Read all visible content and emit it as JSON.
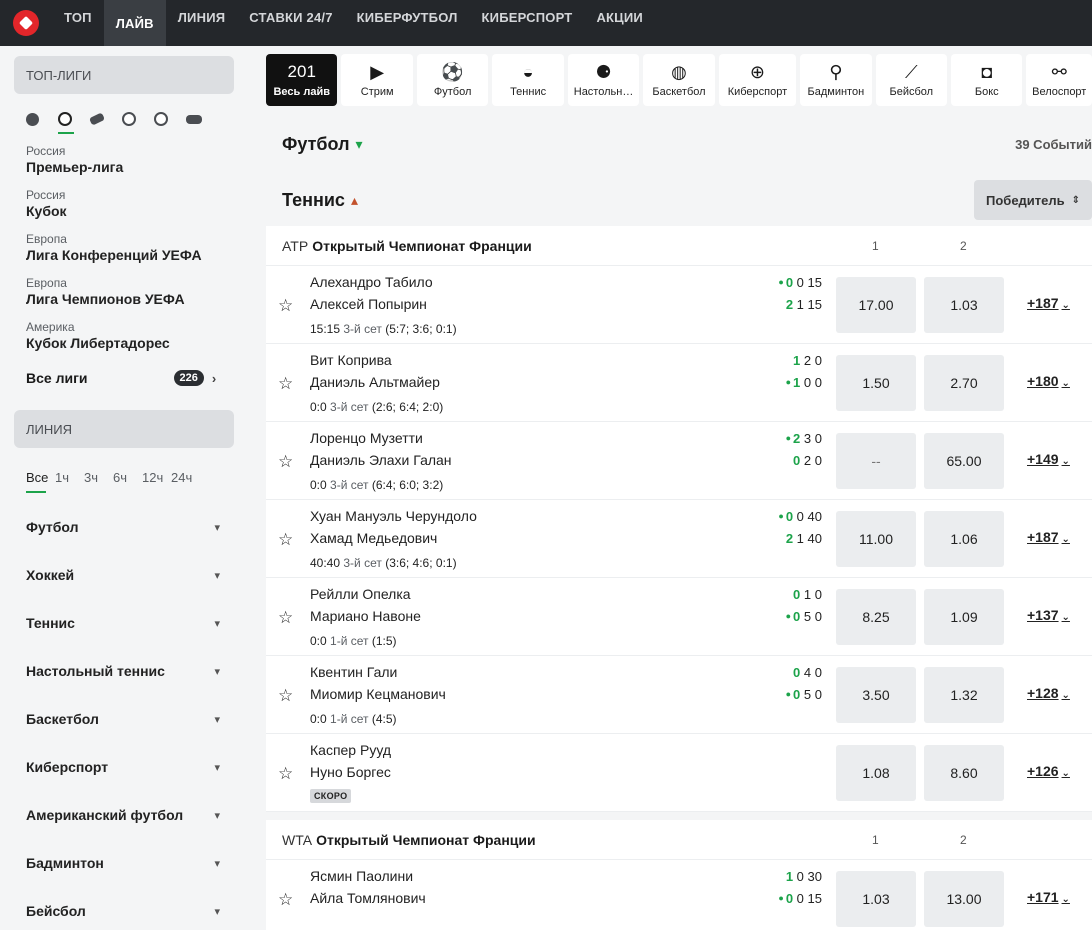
{
  "topnav": {
    "items": [
      {
        "label": "ТОП"
      },
      {
        "label": "ЛАЙВ"
      },
      {
        "label": "ЛИНИЯ"
      },
      {
        "label": "СТАВКИ 24/7"
      },
      {
        "label": "КИБЕРФУТБОЛ"
      },
      {
        "label": "КИБЕРСПОРТ"
      },
      {
        "label": "АКЦИИ"
      }
    ]
  },
  "sidebar": {
    "top_leagues_title": "ТОП-ЛИГИ",
    "leagues": [
      {
        "country": "Россия",
        "name": "Премьер-лига"
      },
      {
        "country": "Россия",
        "name": "Кубок"
      },
      {
        "country": "Европа",
        "name": "Лига Конференций УЕФА"
      },
      {
        "country": "Европа",
        "name": "Лига Чемпионов УЕФА"
      },
      {
        "country": "Америка",
        "name": "Кубок Либертадорес"
      }
    ],
    "all_leagues_label": "Все лиги",
    "all_leagues_count": "226",
    "line_title": "ЛИНИЯ",
    "time_filters": [
      "Все",
      "1ч",
      "3ч",
      "6ч",
      "12ч",
      "24ч"
    ],
    "sports": [
      "Футбол",
      "Хоккей",
      "Теннис",
      "Настольный теннис",
      "Баскетбол",
      "Киберспорт",
      "Американский футбол",
      "Бадминтон",
      "Бейсбол"
    ]
  },
  "tabs": {
    "all_count": "201",
    "all_label": "Весь лайв",
    "items": [
      {
        "label": "Стрим",
        "icon": "play-icon"
      },
      {
        "label": "Футбол",
        "icon": "soccer-ball-icon"
      },
      {
        "label": "Теннис",
        "icon": "tennis-ball-icon"
      },
      {
        "label": "Настольн…",
        "icon": "table-tennis-icon"
      },
      {
        "label": "Баскетбол",
        "icon": "basketball-icon"
      },
      {
        "label": "Киберспорт",
        "icon": "gamepad-icon"
      },
      {
        "label": "Бадминтон",
        "icon": "shuttlecock-icon"
      },
      {
        "label": "Бейсбол",
        "icon": "baseball-bat-icon"
      },
      {
        "label": "Бокс",
        "icon": "boxing-glove-icon"
      },
      {
        "label": "Велоспорт",
        "icon": "bicycle-icon"
      }
    ]
  },
  "football_section": {
    "title": "Футбол",
    "events": "39 Событий"
  },
  "tennis_section": {
    "title": "Теннис",
    "market": "Победитель"
  },
  "competitions": [
    {
      "tour": "ATP",
      "name": "Открытый Чемпионат Франции",
      "col1": "1",
      "col2": "2",
      "matches": [
        {
          "p1": "Алехандро Табило",
          "p2": "Алексей Попырин",
          "time": "15:15",
          "set": "3-й сет",
          "sets": "(5:7; 3:6; 0:1)",
          "s1": [
            "0",
            "0",
            "15"
          ],
          "s2": [
            "2",
            "1",
            "15"
          ],
          "serve": 1,
          "o1": "17.00",
          "o2": "1.03",
          "more": "+187"
        },
        {
          "p1": "Вит Коприва",
          "p2": "Даниэль Альтмайер",
          "time": "0:0",
          "set": "3-й сет",
          "sets": "(2:6; 6:4; 2:0)",
          "s1": [
            "1",
            "2",
            "0"
          ],
          "s2": [
            "1",
            "0",
            "0"
          ],
          "serve": 2,
          "o1": "1.50",
          "o2": "2.70",
          "more": "+180"
        },
        {
          "p1": "Лоренцо Музетти",
          "p2": "Даниэль Элахи Галан",
          "time": "0:0",
          "set": "3-й сет",
          "sets": "(6:4; 6:0; 3:2)",
          "s1": [
            "2",
            "3",
            "0"
          ],
          "s2": [
            "0",
            "2",
            "0"
          ],
          "serve": 1,
          "o1": "--",
          "o2": "65.00",
          "more": "+149"
        },
        {
          "p1": "Хуан Мануэль Черундоло",
          "p2": "Хамад Медьедович",
          "time": "40:40",
          "set": "3-й сет",
          "sets": "(3:6; 4:6; 0:1)",
          "s1": [
            "0",
            "0",
            "40"
          ],
          "s2": [
            "2",
            "1",
            "40"
          ],
          "serve": 1,
          "o1": "11.00",
          "o2": "1.06",
          "more": "+187"
        },
        {
          "p1": "Рейлли Опелка",
          "p2": "Мариано Навоне",
          "time": "0:0",
          "set": "1-й сет",
          "sets": "(1:5)",
          "s1": [
            "0",
            "1",
            "0"
          ],
          "s2": [
            "0",
            "5",
            "0"
          ],
          "serve": 2,
          "o1": "8.25",
          "o2": "1.09",
          "more": "+137"
        },
        {
          "p1": "Квентин Гали",
          "p2": "Миомир Кецманович",
          "time": "0:0",
          "set": "1-й сет",
          "sets": "(4:5)",
          "s1": [
            "0",
            "4",
            "0"
          ],
          "s2": [
            "0",
            "5",
            "0"
          ],
          "serve": 2,
          "o1": "3.50",
          "o2": "1.32",
          "more": "+128"
        },
        {
          "p1": "Каспер Рууд",
          "p2": "Нуно Боргес",
          "badge": "СКОРО",
          "o1": "1.08",
          "o2": "8.60",
          "more": "+126"
        }
      ]
    },
    {
      "tour": "WTA",
      "name": "Открытый Чемпионат Франции",
      "col1": "1",
      "col2": "2",
      "matches": [
        {
          "p1": "Ясмин Паолини",
          "p2": "Айла Томлянович",
          "s1": [
            "1",
            "0",
            "30"
          ],
          "s2": [
            "0",
            "0",
            "15"
          ],
          "serve": 2,
          "o1": "1.03",
          "o2": "13.00",
          "more": "+171"
        }
      ]
    }
  ]
}
